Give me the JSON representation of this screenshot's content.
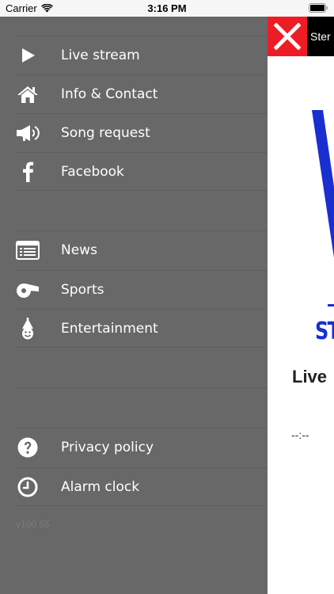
{
  "status_bar": {
    "carrier": "Carrier",
    "time": "3:16 PM"
  },
  "drawer": {
    "groups": [
      {
        "items": [
          {
            "label": "Live stream",
            "icon": "play-icon"
          },
          {
            "label": "Info & Contact",
            "icon": "home-icon"
          },
          {
            "label": "Song request",
            "icon": "megaphone-icon"
          },
          {
            "label": "Facebook",
            "icon": "facebook-icon"
          }
        ]
      },
      {
        "items": [
          {
            "label": "News",
            "icon": "newspaper-icon"
          },
          {
            "label": "Sports",
            "icon": "whistle-icon"
          },
          {
            "label": "Entertainment",
            "icon": "clown-icon"
          }
        ]
      },
      {
        "items": [
          {
            "label": "Privacy policy",
            "icon": "question-icon"
          },
          {
            "label": "Alarm clock",
            "icon": "clock-icon"
          }
        ]
      }
    ],
    "version": "v100.55"
  },
  "content": {
    "header_text": "Ster",
    "title": "Live",
    "logo_text": "ST",
    "time_readout": "--:--"
  },
  "colors": {
    "drawer_bg": "#686868",
    "close_red": "#ee1c25",
    "logo_blue": "#1a2fd0"
  }
}
